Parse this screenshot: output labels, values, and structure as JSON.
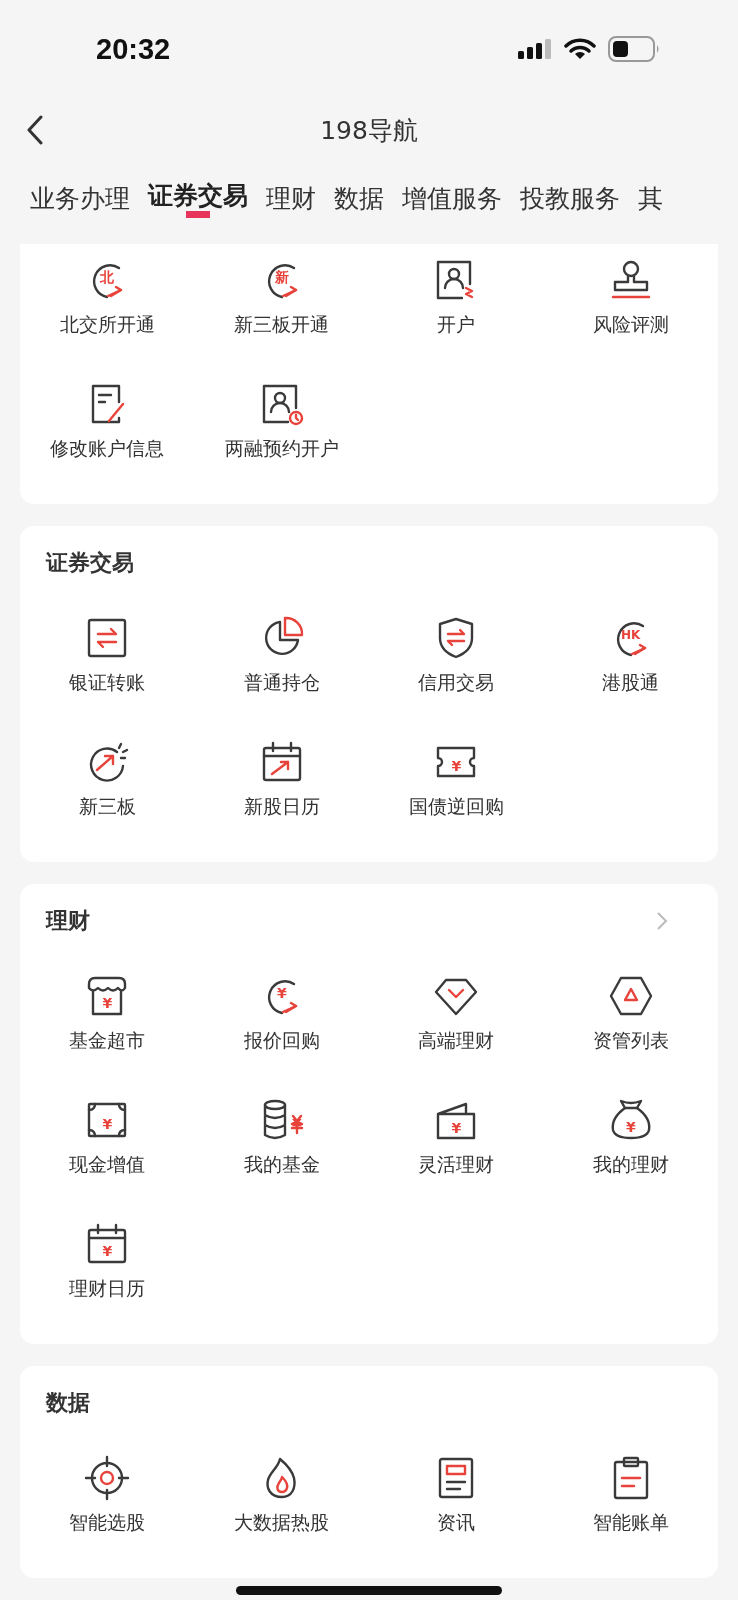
{
  "status_bar": {
    "time": "20:32"
  },
  "header": {
    "title": "198导航"
  },
  "tabs": [
    {
      "label": "业务办理",
      "selected": false
    },
    {
      "label": "证券交易",
      "selected": true
    },
    {
      "label": "理财",
      "selected": false
    },
    {
      "label": "数据",
      "selected": false
    },
    {
      "label": "增值服务",
      "selected": false
    },
    {
      "label": "投教服务",
      "selected": false
    },
    {
      "label": "其",
      "selected": false
    }
  ],
  "sections": [
    {
      "has_more": false,
      "items": [
        {
          "label": "北交所开通",
          "glyph": "北"
        },
        {
          "label": "新三板开通",
          "glyph": "新"
        },
        {
          "label": "开户"
        },
        {
          "label": "风险评测"
        },
        {
          "label": "修改账户信息"
        },
        {
          "label": "两融预约开户"
        }
      ]
    },
    {
      "title": "证券交易",
      "has_more": false,
      "items": [
        {
          "label": "银证转账"
        },
        {
          "label": "普通持仓"
        },
        {
          "label": "信用交易"
        },
        {
          "label": "港股通",
          "glyph": "HK"
        },
        {
          "label": "新三板"
        },
        {
          "label": "新股日历"
        },
        {
          "label": "国债逆回购",
          "glyph": "¥"
        }
      ]
    },
    {
      "title": "理财",
      "has_more": true,
      "items": [
        {
          "label": "基金超市",
          "glyph": "¥"
        },
        {
          "label": "报价回购",
          "glyph": "¥"
        },
        {
          "label": "高端理财"
        },
        {
          "label": "资管列表"
        },
        {
          "label": "现金增值",
          "glyph": "¥"
        },
        {
          "label": "我的基金",
          "glyph": "¥"
        },
        {
          "label": "灵活理财",
          "glyph": "¥"
        },
        {
          "label": "我的理财",
          "glyph": "¥"
        },
        {
          "label": "理财日历",
          "glyph": "¥"
        }
      ]
    },
    {
      "title": "数据",
      "has_more": false,
      "items": [
        {
          "label": "智能选股"
        },
        {
          "label": "大数据热股"
        },
        {
          "label": "资讯"
        },
        {
          "label": "智能账单"
        }
      ]
    }
  ]
}
